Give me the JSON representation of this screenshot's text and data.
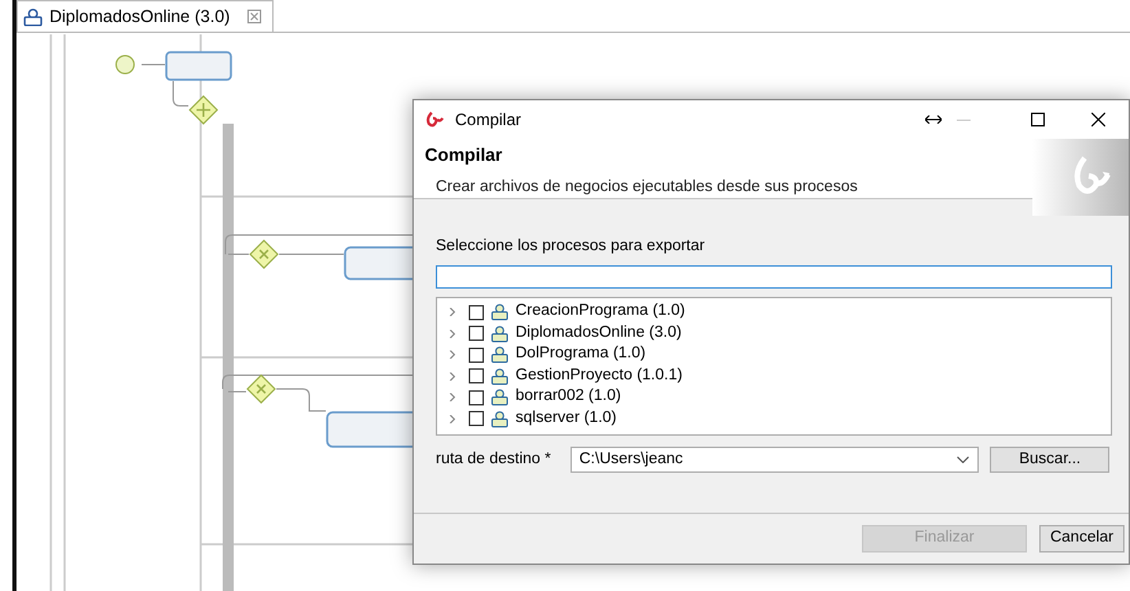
{
  "editor_tab": {
    "title": "DiplomadosOnline (3.0)",
    "selected": true
  },
  "dialog": {
    "title": "Compilar",
    "header_title": "Compilar",
    "header_description": "Crear archivos de negocios ejecutables desde sus procesos",
    "select_label": "Seleccione los procesos para exportar",
    "processes": [
      {
        "label": "CreacionPrograma (1.0)",
        "checked": false,
        "expanded": false
      },
      {
        "label": "DiplomadosOnline (3.0)",
        "checked": false,
        "expanded": false
      },
      {
        "label": "DolPrograma (1.0)",
        "checked": false,
        "expanded": false
      },
      {
        "label": "GestionProyecto (1.0.1)",
        "checked": false,
        "expanded": false
      },
      {
        "label": "borrar002 (1.0)",
        "checked": false,
        "expanded": false
      },
      {
        "label": "sqlserver (1.0)",
        "checked": false,
        "expanded": false
      }
    ],
    "destination": {
      "label": "ruta de destino *",
      "value": "C:\\Users\\jeanc",
      "browse": "Buscar..."
    },
    "buttons": [
      {
        "label": "Finalizar",
        "disabled": true
      },
      {
        "label": "Cancelar",
        "disabled": false
      }
    ]
  }
}
